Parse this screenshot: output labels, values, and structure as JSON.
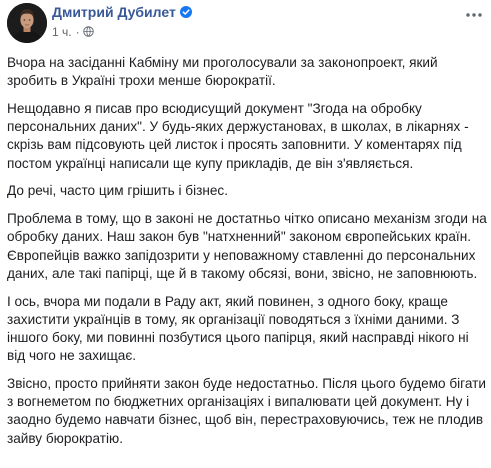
{
  "post": {
    "author": {
      "name": "Дмитрий Дубилет",
      "verified": true,
      "avatar_icon": "person-photo-avatar"
    },
    "timestamp": "1 ч.",
    "audience_icon": "globe-icon",
    "more_icon": "more-dots-icon",
    "paragraphs": [
      "Вчора на засіданні Кабміну ми проголосували за законопроект, який зробить в Україні трохи менше бюрократії.",
      "Нещодавно я писав про всюдисущий документ \"Згода на обробку персональних даних\". У будь-яких держустановах, в школах, в лікарнях - скрізь вам підсовують цей листок і просять заповнити. У коментарях під постом українці написали ще купу прикладів, де він з'являється.",
      "До речі, часто цим грішить і бізнес.",
      "Проблема в тому, що в законі не достатньо чітко описано механізм згоди на обробку даних. Наш закон був \"натхненний\" законом європейських країн. Європейців важко запідозрити у неповажному ставленні до персональних даних, але такі папірці, ще й в такому обсязі, вони, звісно, не заповнюють.",
      "І ось, вчора ми подали в Раду акт, який повинен, з одного боку, краще захистити українців в тому, як організації поводяться з їхніми даними. З іншого боку, ми повинні позбутися цього папірця, який насправді нікого ні від чого не захищає.",
      "Звісно, просто прийняти закон буде недостатньо. Після цього будемо бігати з вогнеметом по бюджетних організаціях і випалювати цей документ. Ну і заодно будемо навчати бізнес, щоб він, перестраховуючись, теж не плодив зайву бюрократію."
    ]
  },
  "colors": {
    "author_link": "#385898",
    "verified_badge": "#1877f2",
    "meta_text": "#616770",
    "body_text": "#1c1e21",
    "background": "#ffffff"
  }
}
